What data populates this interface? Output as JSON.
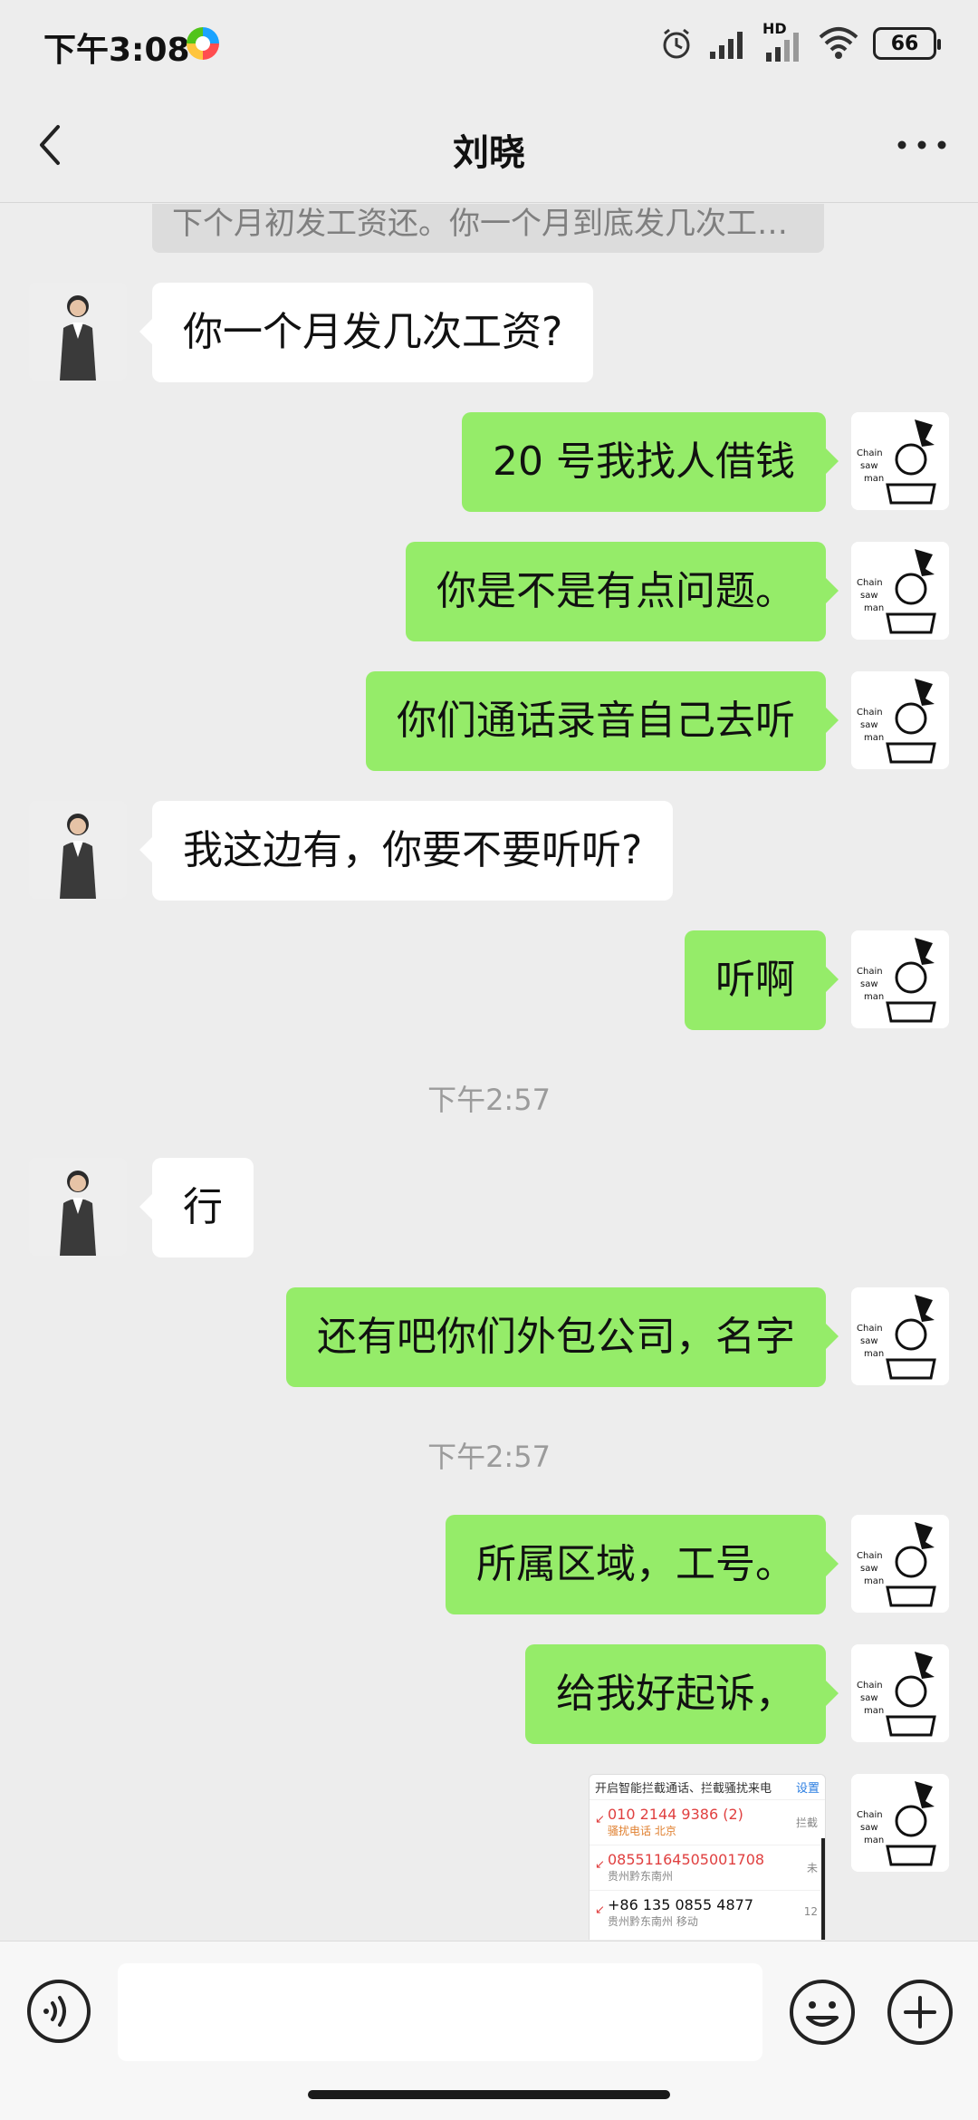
{
  "status_bar": {
    "time": "下午3:08",
    "network_label": "HD",
    "battery": "66"
  },
  "header": {
    "title": "刘晓",
    "back_icon": "chevron-left-icon",
    "more_icon": "more-horizontal-icon"
  },
  "quoted_message": "下个月初发工资还。你一个月到底发几次工资？",
  "messages": [
    {
      "side": "left",
      "text": "你一个月发几次工资?"
    },
    {
      "side": "right",
      "text": "20 号我找人借钱"
    },
    {
      "side": "right",
      "text": "你是不是有点问题。"
    },
    {
      "side": "right",
      "text": "你们通话录音自己去听"
    },
    {
      "side": "left",
      "text": "我这边有，你要不要听听?"
    },
    {
      "side": "right",
      "text": "听啊"
    },
    {
      "side": "left",
      "text": "行"
    },
    {
      "side": "right",
      "text": "还有吧你们外包公司，名字"
    },
    {
      "side": "right",
      "text": "所属区域，工号。"
    },
    {
      "side": "right",
      "text": "给我好起诉，"
    }
  ],
  "timestamps": [
    "下午2:57",
    "下午2:57"
  ],
  "image_message": {
    "header_left": "开启智能拦截通话、拦截骚扰来电",
    "header_right": "设置",
    "calls": [
      {
        "number": "010 2144 9386 (2)",
        "location": "骚扰电话  北京",
        "tag": "拦截"
      },
      {
        "number": "08551164505001708",
        "location": "贵州黔东南州",
        "tag": "未"
      },
      {
        "number": "+86 135 0855 4877",
        "location": "贵州黔东南州 移动",
        "tag": "12"
      }
    ]
  },
  "input": {
    "placeholder": "",
    "voice_icon": "voice-icon",
    "emoji_icon": "emoji-icon",
    "plus_icon": "plus-icon"
  }
}
